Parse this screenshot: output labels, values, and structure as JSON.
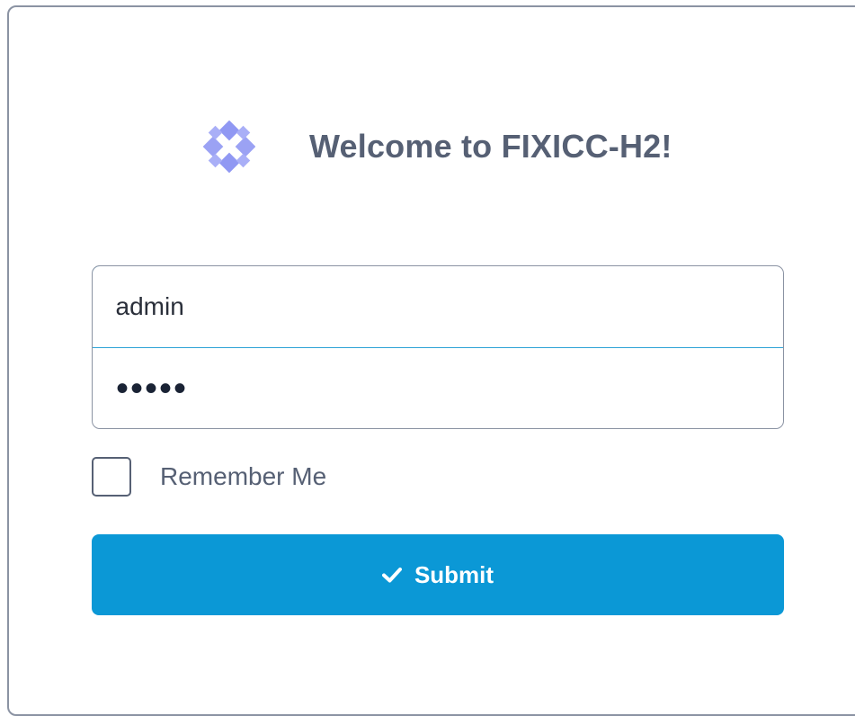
{
  "login": {
    "title": "Welcome to FIXICC-H2!",
    "logo_icon": "cross-diamond-logo-icon",
    "username": {
      "value": "admin",
      "placeholder": ""
    },
    "password": {
      "value": "•••••",
      "placeholder": ""
    },
    "remember_me": {
      "label": "Remember Me",
      "checked": false
    },
    "submit": {
      "label": "Submit",
      "icon": "checkmark-icon"
    }
  },
  "colors": {
    "accent": "#0b98d6",
    "input_focus_border": "#2ea3d6",
    "text": "#566074",
    "border": "#8b93a3",
    "logo": "#8a92f2"
  }
}
